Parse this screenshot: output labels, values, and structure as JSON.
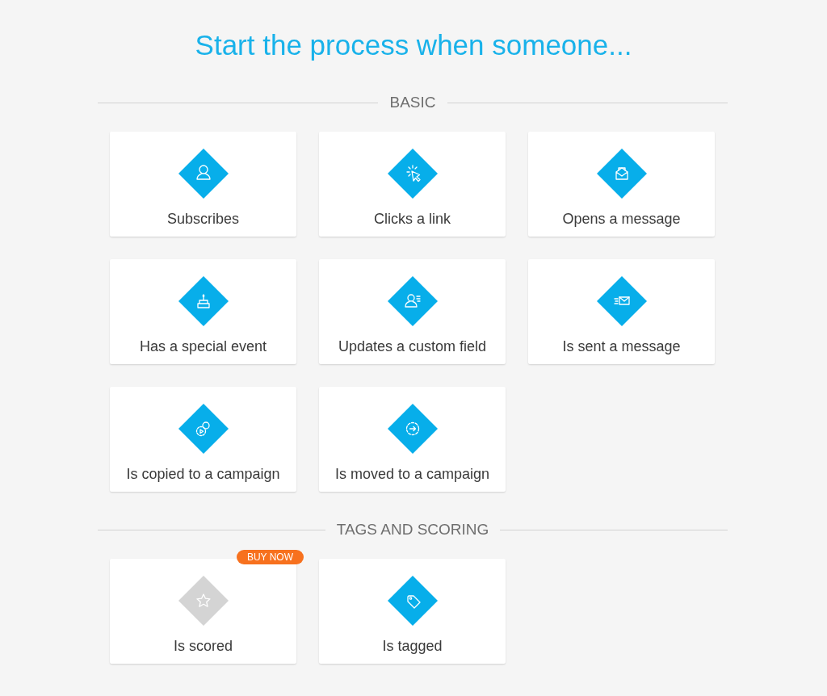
{
  "title": "Start the process when someone...",
  "sections": [
    {
      "heading": "BASIC",
      "cards": [
        {
          "label": "Subscribes",
          "kind": "person",
          "locked": false
        },
        {
          "label": "Clicks a link",
          "kind": "cursor",
          "locked": false
        },
        {
          "label": "Opens a message",
          "kind": "open-envelope",
          "locked": false
        },
        {
          "label": "Has a special event",
          "kind": "cake",
          "locked": false
        },
        {
          "label": "Updates a custom field",
          "kind": "person-lines",
          "locked": false
        },
        {
          "label": "Is sent a message",
          "kind": "sent-envelope",
          "locked": false
        },
        {
          "label": "Is copied to a campaign",
          "kind": "gears-play",
          "locked": false
        },
        {
          "label": "Is moved to a campaign",
          "kind": "gear-arrow",
          "locked": false
        }
      ]
    },
    {
      "heading": "TAGS AND SCORING",
      "cards": [
        {
          "label": "Is scored",
          "kind": "star",
          "locked": true,
          "badge": "BUY NOW"
        },
        {
          "label": "Is tagged",
          "kind": "tag",
          "locked": false
        }
      ]
    }
  ]
}
